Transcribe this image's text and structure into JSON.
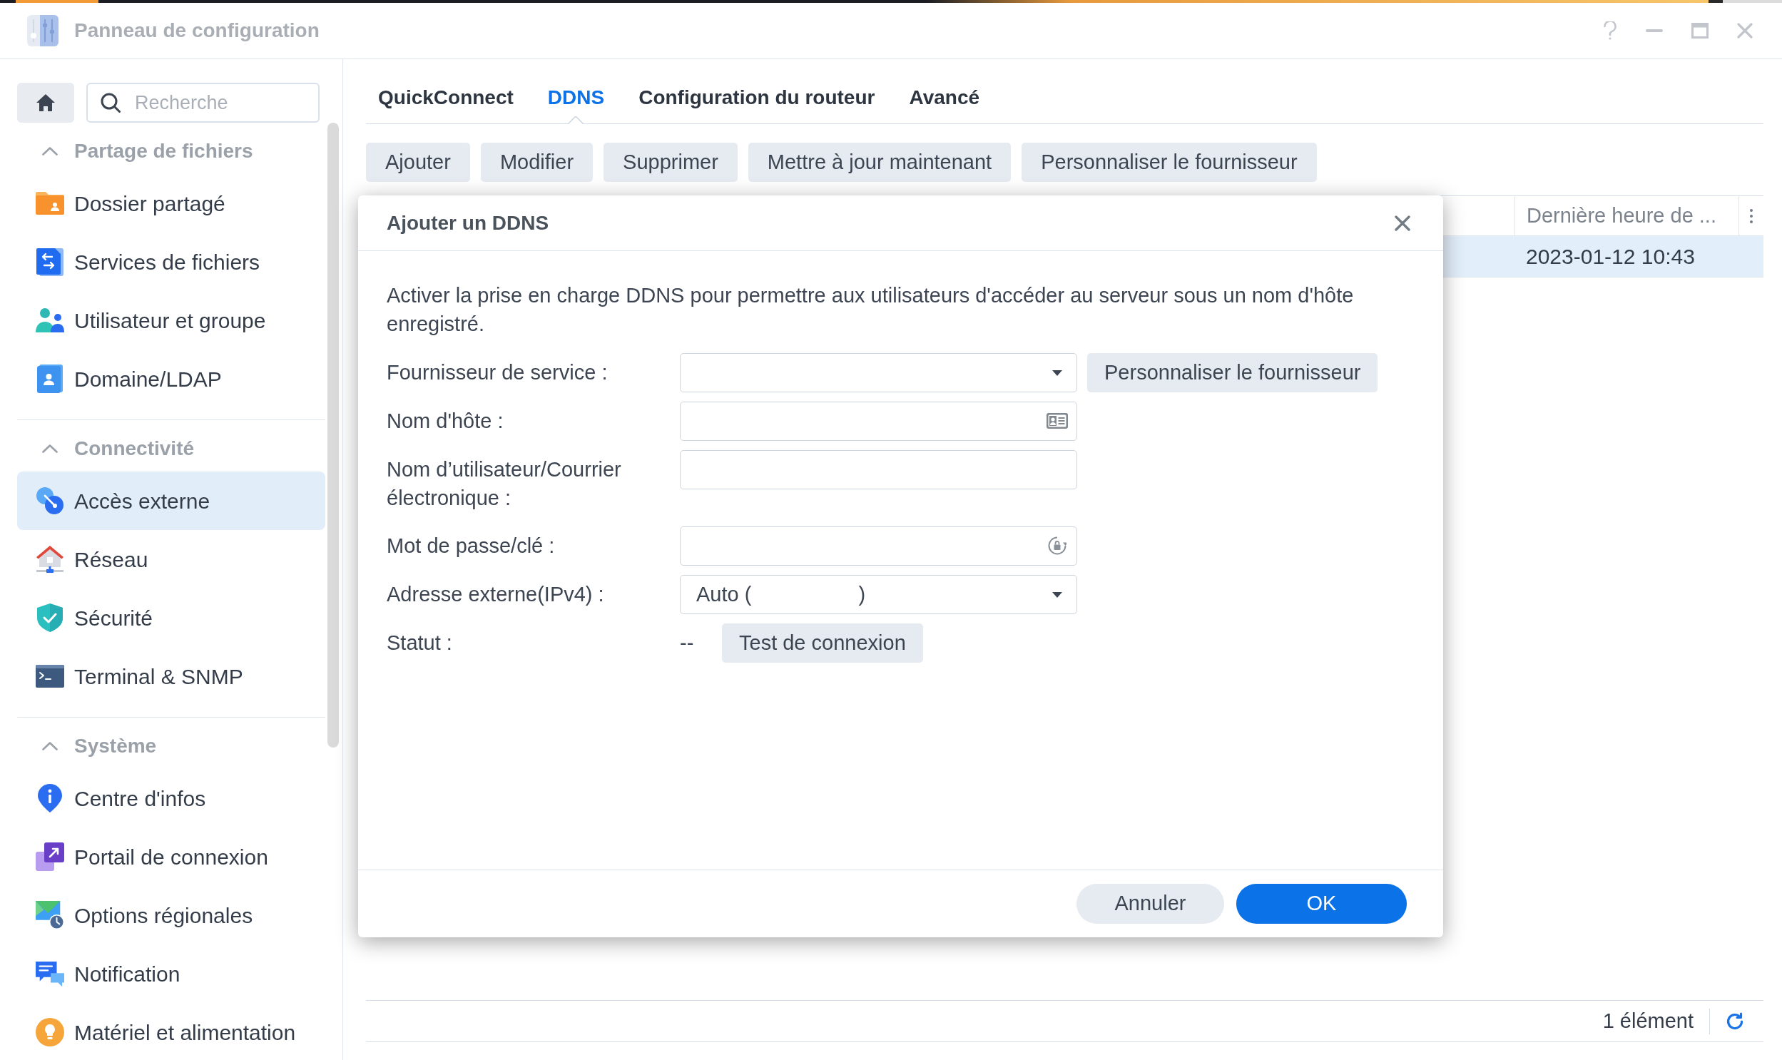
{
  "window": {
    "title": "Panneau de configuration"
  },
  "sidebar": {
    "search": {
      "placeholder": "Recherche"
    },
    "sections": [
      {
        "title": "Partage de fichiers",
        "expanded": true,
        "items": [
          {
            "label": "Dossier partagé",
            "selected": false
          },
          {
            "label": "Services de fichiers",
            "selected": false
          },
          {
            "label": "Utilisateur et groupe",
            "selected": false
          },
          {
            "label": "Domaine/LDAP",
            "selected": false
          }
        ]
      },
      {
        "title": "Connectivité",
        "expanded": true,
        "items": [
          {
            "label": "Accès externe",
            "selected": true
          },
          {
            "label": "Réseau",
            "selected": false
          },
          {
            "label": "Sécurité",
            "selected": false
          },
          {
            "label": "Terminal & SNMP",
            "selected": false
          }
        ]
      },
      {
        "title": "Système",
        "expanded": true,
        "items": [
          {
            "label": "Centre d'infos",
            "selected": false
          },
          {
            "label": "Portail de connexion",
            "selected": false
          },
          {
            "label": "Options régionales",
            "selected": false
          },
          {
            "label": "Notification",
            "selected": false
          },
          {
            "label": "Matériel et alimentation",
            "selected": false
          }
        ]
      }
    ]
  },
  "tabs": [
    {
      "label": "QuickConnect",
      "selected": false
    },
    {
      "label": "DDNS",
      "selected": true
    },
    {
      "label": "Configuration du routeur",
      "selected": false
    },
    {
      "label": "Avancé",
      "selected": false
    }
  ],
  "toolbar": {
    "buttons": [
      "Ajouter",
      "Modifier",
      "Supprimer",
      "Mettre à jour maintenant",
      "Personnaliser le fournisseur"
    ]
  },
  "table": {
    "columns": [
      {
        "label": "Dernière heure de ..."
      }
    ],
    "rows": [
      {
        "cells": [
          "2023-01-12 10:43"
        ],
        "selected": true
      }
    ]
  },
  "status_bar": {
    "count": "1 élément"
  },
  "dialog": {
    "title": "Ajouter un DDNS",
    "description": "Activer la prise en charge DDNS pour permettre aux utilisateurs d'accéder au serveur sous un nom d'hôte enregistré.",
    "fields": [
      {
        "kind": "select",
        "label": "Fournisseur de service :",
        "button": "Personnaliser le fournisseur"
      },
      {
        "kind": "lookup",
        "label": "Nom d'hôte :"
      },
      {
        "kind": "text",
        "label": "Nom d’utilisateur/Courrier électronique :"
      },
      {
        "kind": "password",
        "label": "Mot de passe/clé :"
      },
      {
        "kind": "select",
        "label": "Adresse externe(IPv4) :",
        "value_parts": [
          "Auto (",
          ")"
        ]
      },
      {
        "kind": "status",
        "label": "Statut :",
        "value": "--",
        "button": "Test de connexion"
      }
    ],
    "buttons": [
      {
        "label": "Annuler",
        "primary": false
      },
      {
        "label": "OK",
        "primary": true
      }
    ]
  }
}
